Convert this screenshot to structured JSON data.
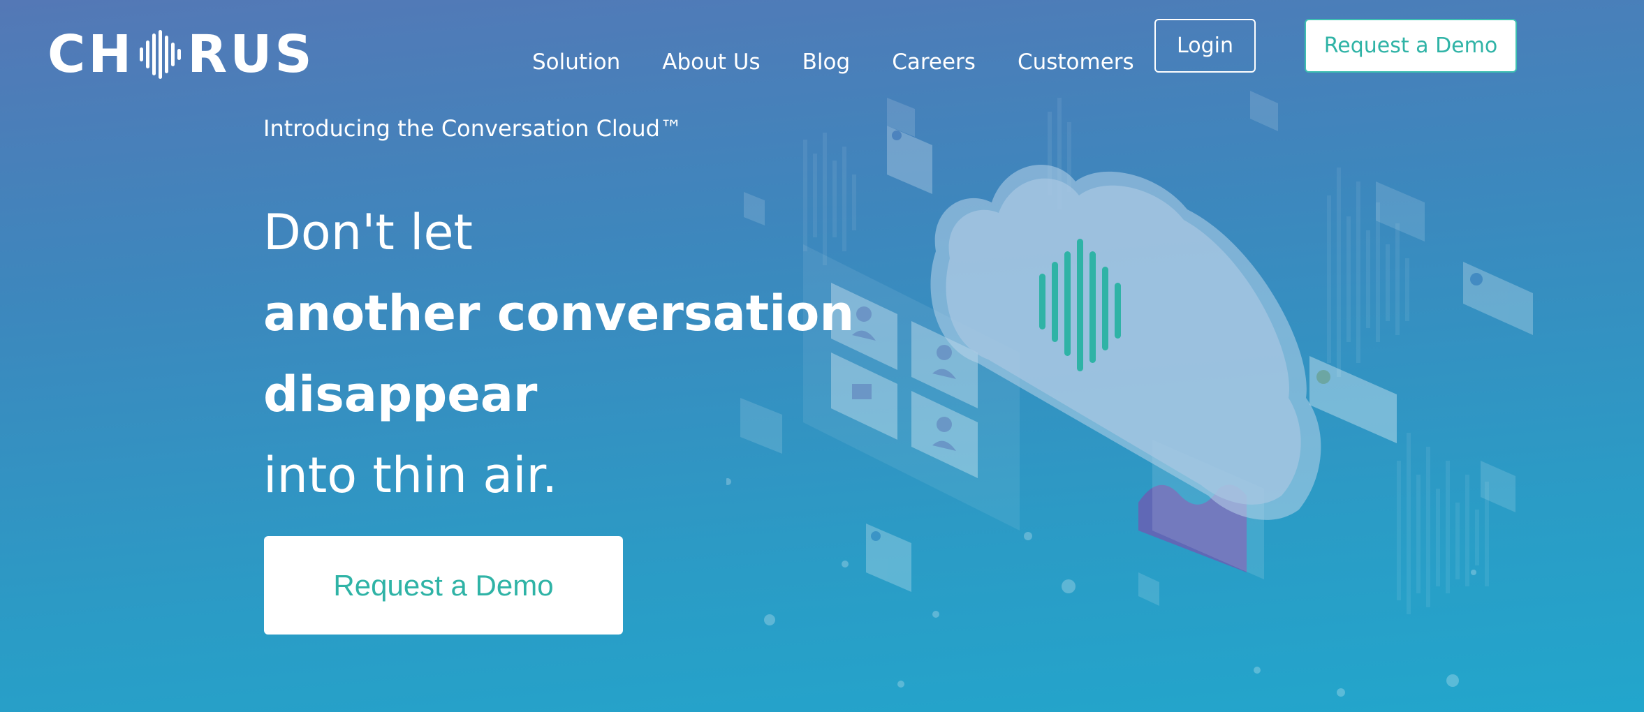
{
  "brand": {
    "logo_left": "CH",
    "logo_right": "RUS",
    "logo_icon": "soundwave-icon"
  },
  "nav": {
    "items": [
      {
        "label": "Solution"
      },
      {
        "label": "About Us"
      },
      {
        "label": "Blog"
      },
      {
        "label": "Careers"
      },
      {
        "label": "Customers"
      }
    ],
    "login_label": "Login",
    "demo_label": "Request a Demo"
  },
  "hero": {
    "intro": "Introducing the Conversation Cloud™",
    "line1": "Don't let",
    "line2": "another conversation",
    "line3": "disappear",
    "line4": "into thin air.",
    "cta_label": "Request a Demo"
  },
  "colors": {
    "accent": "#2fb3a6",
    "bg_top": "#5478b6",
    "bg_bottom": "#22a6cc"
  }
}
